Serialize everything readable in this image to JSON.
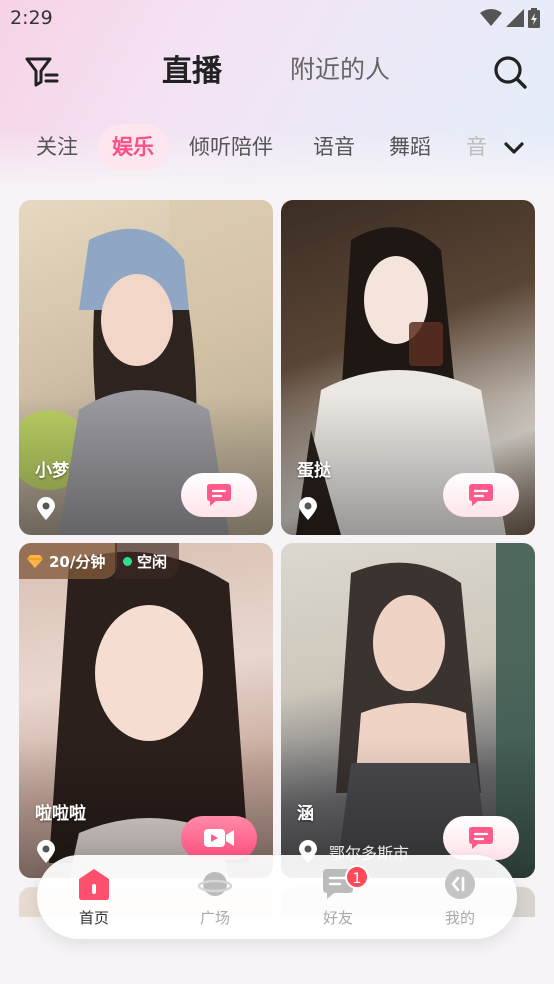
{
  "status_bar": {
    "time": "2:29"
  },
  "header": {
    "tabs": [
      {
        "label": "直播",
        "active": true
      },
      {
        "label": "附近的人",
        "active": false
      }
    ]
  },
  "categories": [
    {
      "label": "关注",
      "active": false
    },
    {
      "label": "娱乐",
      "active": true
    },
    {
      "label": "倾听陪伴",
      "active": false
    },
    {
      "label": "语音",
      "active": false
    },
    {
      "label": "舞蹈",
      "active": false
    },
    {
      "label": "音",
      "active": false
    }
  ],
  "cards": [
    {
      "name": "小梦",
      "location": "",
      "action": "chat"
    },
    {
      "name": "蛋挞",
      "location": "",
      "action": "chat"
    },
    {
      "name": "啦啦啦",
      "location": "",
      "action": "video",
      "price": "20/分钟",
      "status": "空闲"
    },
    {
      "name": "涵",
      "location": "鄂尔多斯市",
      "action": "chat"
    }
  ],
  "tabbar": {
    "items": [
      {
        "label": "首页",
        "icon": "home-icon",
        "active": true
      },
      {
        "label": "广场",
        "icon": "planet-icon",
        "active": false
      },
      {
        "label": "好友",
        "icon": "message-icon",
        "active": false,
        "badge": "1"
      },
      {
        "label": "我的",
        "icon": "profile-icon",
        "active": false
      }
    ]
  },
  "colors": {
    "accent": "#ff4f86",
    "badge": "#ff4a5a",
    "online": "#2ee08a"
  }
}
